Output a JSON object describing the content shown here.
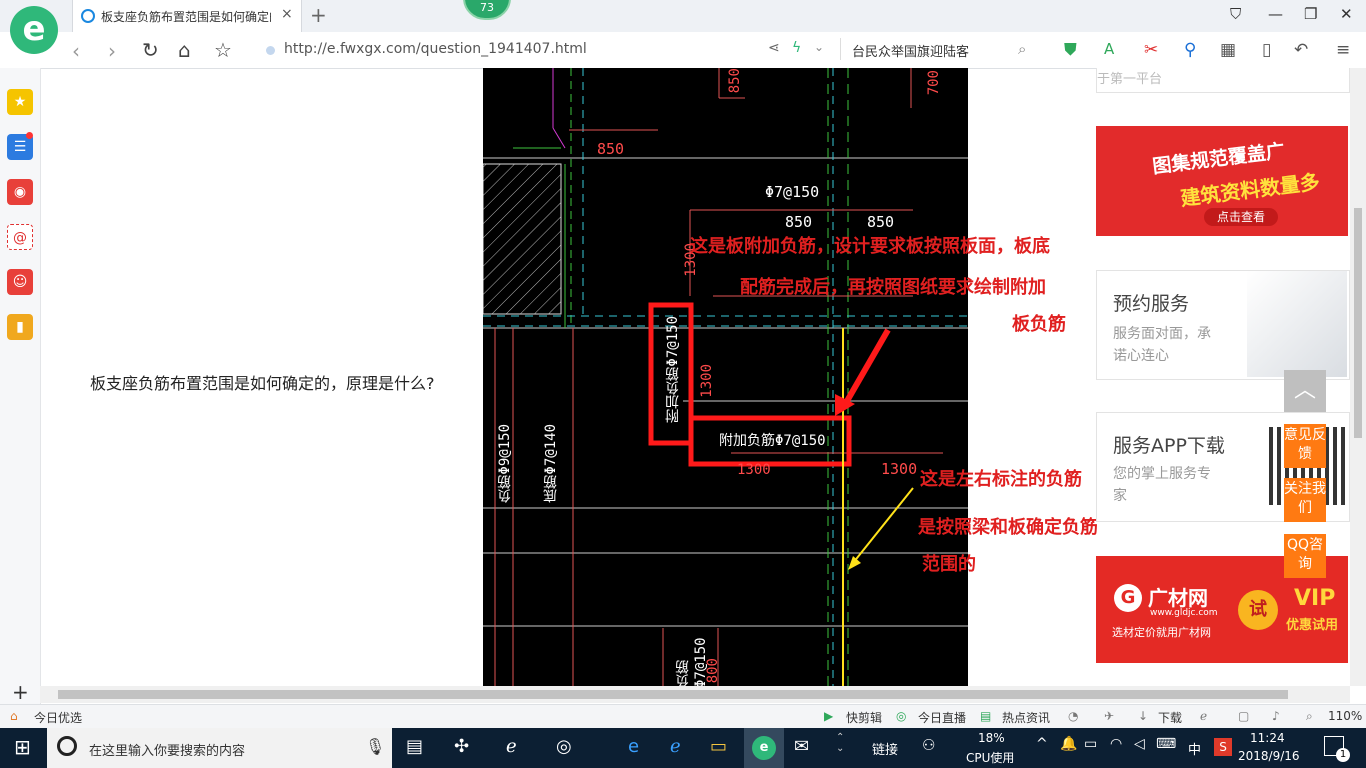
{
  "window": {
    "tab_title": "板支座负筋布置范围是如何确定的",
    "logo_letter": "e",
    "badge_count": "73",
    "new_tab": "+",
    "close_tab": "×"
  },
  "address_bar": {
    "url": "http://e.fwxgx.com/question_1941407.html",
    "search_text": "台民众举国旗迎陆客"
  },
  "page": {
    "question": "板支座负筋布置范围是如何确定的，原理是什么?",
    "cad": {
      "dims": [
        "850",
        "850",
        "850",
        "850",
        "1300",
        "1300",
        "1300",
        "1300",
        "700"
      ],
      "label_top": "Φ7@150",
      "label_h": "附加负筋Φ7@150",
      "label_v": "附加负筋Φ7@150",
      "label_left1": "负筋Φ9@150",
      "label_left2": "底筋Φ7@140",
      "label_bottom": "负筋Φ7@150",
      "label_bottom_dim": "800"
    },
    "notes": {
      "note1_line1": "这是板附加负筋，设计要求板按照板面，板底",
      "note1_line2": "配筋完成后，再按照图纸要求绘制附加",
      "note1_line3": "板负筋",
      "note2_line1": "这是左右标注的负筋",
      "note2_line2": "是按照梁和板确定负筋",
      "note2_line3": "范围的"
    }
  },
  "right_column": {
    "ad1_line1": "图集规范覆盖广",
    "ad1_line2": "建筑资料数量多",
    "ad1_btn": "点击查看",
    "service_title": "预约服务",
    "service_sub1": "服务面对面，承",
    "service_sub2": "诺心连心",
    "app_title": "服务APP下载",
    "app_sub1": "您的掌上服务专",
    "app_sub2": "家",
    "gldjc_name": "广材网",
    "gldjc_url": "www.gldjc.com",
    "gldjc_slogan": "选材定价就用广材网",
    "gldjc_try": "试",
    "gldjc_vip": "VIP",
    "gldjc_vip_sub": "优惠试用",
    "top_part": "于第一平台"
  },
  "floating": {
    "feedback": "意见反馈",
    "follow": "关注我们",
    "qq": "QQ咨询"
  },
  "status_bar": {
    "left": "今日优选",
    "kuaijianji": "快剪辑",
    "live": "今日直播",
    "news": "热点资讯",
    "download": "下载",
    "zoom": "110%"
  },
  "taskbar": {
    "search_placeholder": "在这里输入你要搜索的内容",
    "links": "链接",
    "cpu_pct": "18%",
    "cpu_label": "CPU使用",
    "ime": "中",
    "time": "11:24",
    "date": "2018/9/16",
    "notif_count": "1"
  },
  "colors": {
    "accent": "#2fb87a",
    "float_orange": "#ff7a12",
    "ad_red": "#e22b2b",
    "note_red": "#e02020",
    "taskbar": "#0c1f33"
  }
}
